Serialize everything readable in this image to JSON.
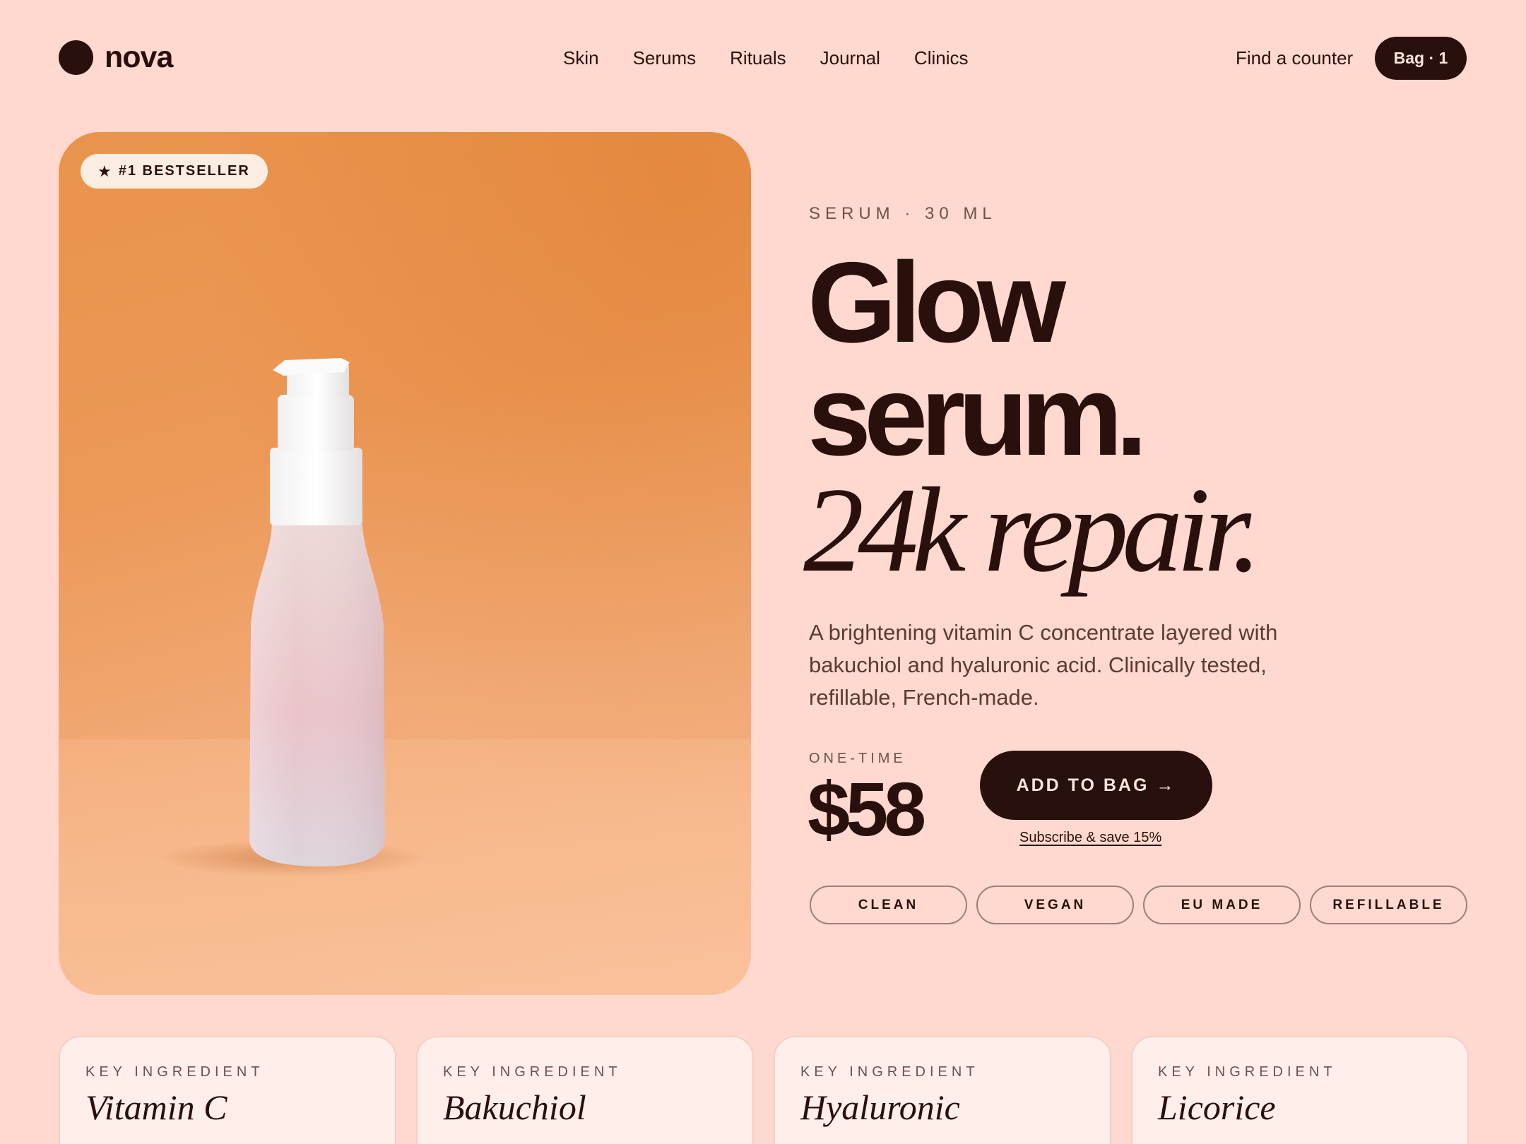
{
  "brand": {
    "name": "nova"
  },
  "nav": [
    "Skin",
    "Serums",
    "Rituals",
    "Journal",
    "Clinics"
  ],
  "header": {
    "find_counter": "Find a counter",
    "bag": "Bag · 1"
  },
  "hero": {
    "badge": "#1 BESTSELLER",
    "badge_icon": "star-icon"
  },
  "product": {
    "eyebrow": "SERUM · 30 ML",
    "headline_line1": "Glow",
    "headline_line2": "serum.",
    "headline_line3": "24k repair.",
    "description": "A brightening vitamin C concentrate layered with bakuchiol and hyaluronic acid. Clinically tested, refillable, French-made.",
    "price_label": "ONE-TIME",
    "price": "$58",
    "add_to_bag": "ADD TO BAG",
    "subscribe": "Subscribe & save 15%",
    "tags": [
      "CLEAN",
      "VEGAN",
      "EU MADE",
      "REFILLABLE"
    ]
  },
  "ingredients": [
    {
      "eyebrow": "KEY INGREDIENT",
      "name": "Vitamin C"
    },
    {
      "eyebrow": "KEY INGREDIENT",
      "name": "Bakuchiol"
    },
    {
      "eyebrow": "KEY INGREDIENT",
      "name": "Hyaluronic"
    },
    {
      "eyebrow": "KEY INGREDIENT",
      "name": "Licorice"
    }
  ],
  "colors": {
    "background": "#ffd9d0",
    "ink": "#2a100c",
    "hero": "#ec9857",
    "card": "#ffeeea"
  }
}
